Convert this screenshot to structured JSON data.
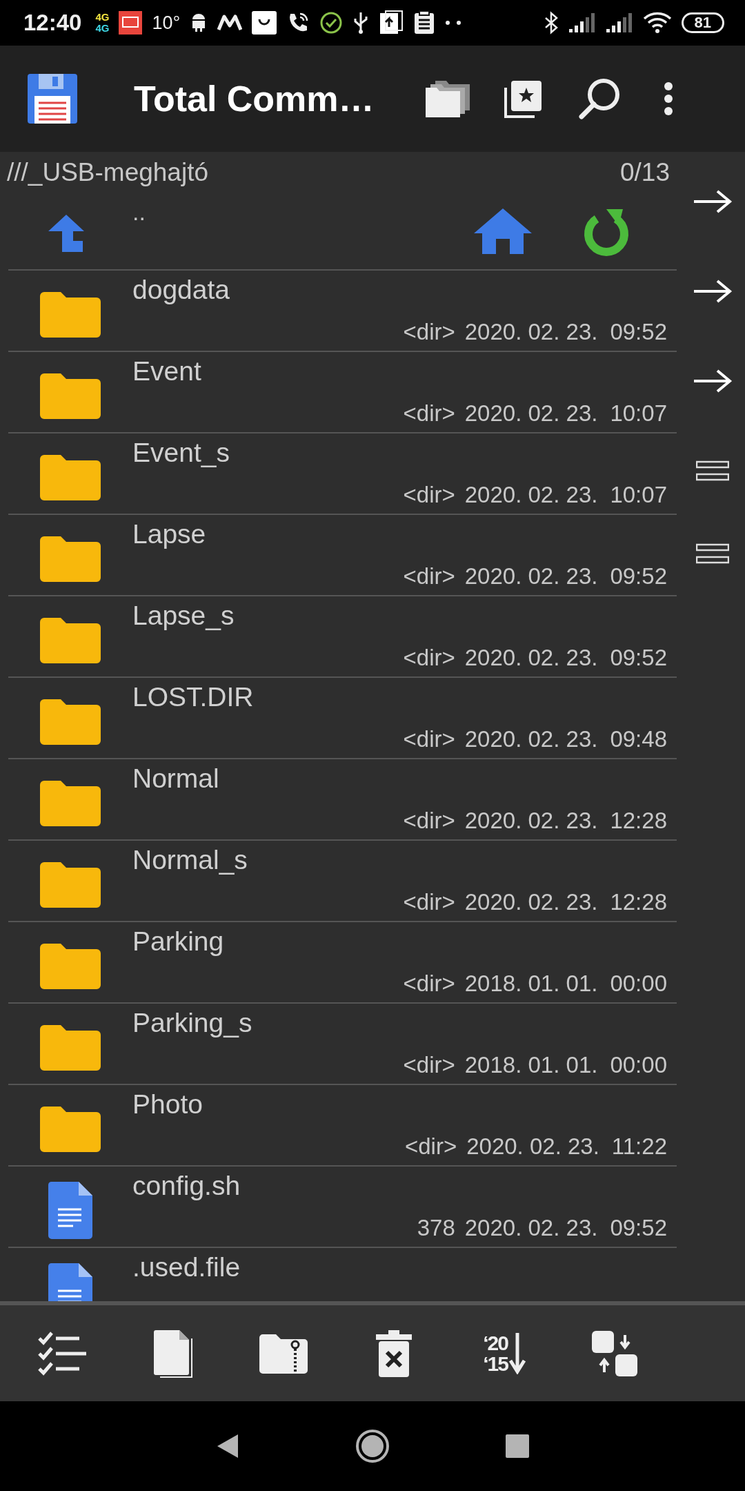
{
  "status_bar": {
    "time": "12:40",
    "network": [
      "4G",
      "4G"
    ],
    "temperature": "10°",
    "battery": "81"
  },
  "app_bar": {
    "title": "Total Comm…"
  },
  "panel": {
    "path": "///_USB-meghajtó",
    "count": "0/13",
    "parent": ".."
  },
  "files": [
    {
      "kind": "folder",
      "name": "dogdata",
      "size": "<dir>",
      "date": "2020. 02. 23.",
      "time": "09:52"
    },
    {
      "kind": "folder",
      "name": "Event",
      "size": "<dir>",
      "date": "2020. 02. 23.",
      "time": "10:07"
    },
    {
      "kind": "folder",
      "name": "Event_s",
      "size": "<dir>",
      "date": "2020. 02. 23.",
      "time": "10:07"
    },
    {
      "kind": "folder",
      "name": "Lapse",
      "size": "<dir>",
      "date": "2020. 02. 23.",
      "time": "09:52"
    },
    {
      "kind": "folder",
      "name": "Lapse_s",
      "size": "<dir>",
      "date": "2020. 02. 23.",
      "time": "09:52"
    },
    {
      "kind": "folder",
      "name": "LOST.DIR",
      "size": "<dir>",
      "date": "2020. 02. 23.",
      "time": "09:48"
    },
    {
      "kind": "folder",
      "name": "Normal",
      "size": "<dir>",
      "date": "2020. 02. 23.",
      "time": "12:28"
    },
    {
      "kind": "folder",
      "name": "Normal_s",
      "size": "<dir>",
      "date": "2020. 02. 23.",
      "time": "12:28"
    },
    {
      "kind": "folder",
      "name": "Parking",
      "size": "<dir>",
      "date": "2018. 01. 01.",
      "time": "00:00"
    },
    {
      "kind": "folder",
      "name": "Parking_s",
      "size": "<dir>",
      "date": "2018. 01. 01.",
      "time": "00:00"
    },
    {
      "kind": "folder",
      "name": "Photo",
      "size": "<dir>",
      "date": "2020. 02. 23.",
      "time": "11:22"
    },
    {
      "kind": "file",
      "name": "config.sh",
      "size": "378",
      "date": "2020. 02. 23.",
      "time": "09:52"
    },
    {
      "kind": "file",
      "name": ".used.file"
    }
  ],
  "side_buttons": [
    {
      "kind": "arrow"
    },
    {
      "kind": "arrow"
    },
    {
      "kind": "arrow"
    },
    {
      "kind": "lines"
    },
    {
      "kind": "lines"
    }
  ],
  "toolbar": {
    "sort_labels": [
      "‘20",
      "‘15"
    ]
  }
}
